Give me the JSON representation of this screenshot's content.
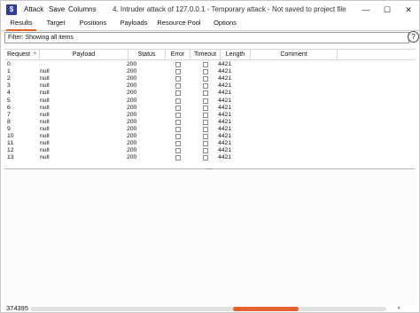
{
  "window": {
    "title": "4. Intruder attack of 127.0.0.1 - Temporary attack - Not saved to project file",
    "app_icon": "burp-icon"
  },
  "menu": [
    "Attack",
    "Save",
    "Columns"
  ],
  "tabs": [
    "Results",
    "Target",
    "Positions",
    "Payloads",
    "Resource Pool",
    "Options"
  ],
  "active_tab": "Results",
  "filter": {
    "text": "Filter: Showing all items"
  },
  "help_label": "?",
  "table": {
    "columns": [
      "Request",
      "Payload",
      "Status",
      "Error",
      "Timeout",
      "Length",
      "Comment"
    ],
    "sort_indicator": "^",
    "rows": [
      {
        "request": "0",
        "payload": "",
        "status": "200",
        "length": "4421"
      },
      {
        "request": "1",
        "payload": "null",
        "status": "200",
        "length": "4421"
      },
      {
        "request": "2",
        "payload": "null",
        "status": "200",
        "length": "4421"
      },
      {
        "request": "3",
        "payload": "null",
        "status": "200",
        "length": "4421"
      },
      {
        "request": "4",
        "payload": "null",
        "status": "200",
        "length": "4421"
      },
      {
        "request": "5",
        "payload": "null",
        "status": "200",
        "length": "4421"
      },
      {
        "request": "6",
        "payload": "null",
        "status": "200",
        "length": "4421"
      },
      {
        "request": "7",
        "payload": "null",
        "status": "200",
        "length": "4421"
      },
      {
        "request": "8",
        "payload": "null",
        "status": "200",
        "length": "4421"
      },
      {
        "request": "9",
        "payload": "null",
        "status": "200",
        "length": "4421"
      },
      {
        "request": "10",
        "payload": "null",
        "status": "200",
        "length": "4421"
      },
      {
        "request": "11",
        "payload": "null",
        "status": "200",
        "length": "4421"
      },
      {
        "request": "12",
        "payload": "null",
        "status": "200",
        "length": "4421"
      },
      {
        "request": "13",
        "payload": "null",
        "status": "200",
        "length": "4421"
      }
    ]
  },
  "footer": {
    "count": "374395"
  },
  "colors": {
    "accent": "#e8612c",
    "app_icon_bg": "#2f3e9e"
  }
}
